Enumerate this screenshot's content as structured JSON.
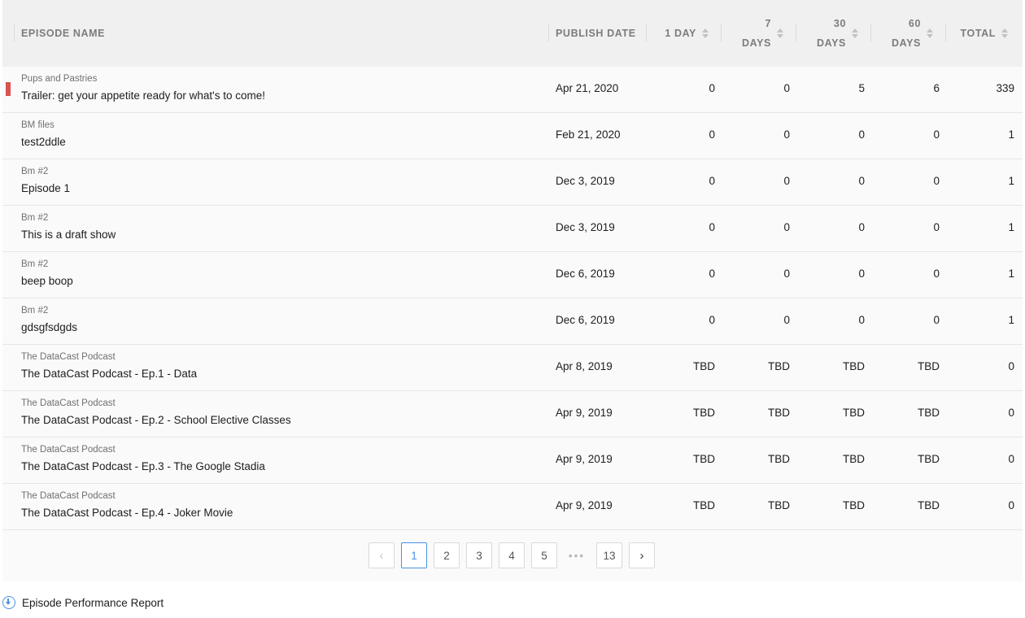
{
  "table": {
    "columns": {
      "episode_name": "EPISODE NAME",
      "publish_date": "PUBLISH DATE",
      "day1": "1 DAY",
      "day7": [
        "7",
        "DAYS"
      ],
      "day30": [
        "30",
        "DAYS"
      ],
      "day60": [
        "60",
        "DAYS"
      ],
      "total": "TOTAL"
    },
    "rows": [
      {
        "show": "Pups and Pastries",
        "episode": "Trailer: get your appetite ready for what's to come!",
        "date": "Apr 21, 2020",
        "d1": "0",
        "d7": "0",
        "d30": "5",
        "d60": "6",
        "total": "339",
        "marker": true
      },
      {
        "show": "BM files",
        "episode": "test2ddle",
        "date": "Feb 21, 2020",
        "d1": "0",
        "d7": "0",
        "d30": "0",
        "d60": "0",
        "total": "1"
      },
      {
        "show": "Bm #2",
        "episode": "Episode 1",
        "date": "Dec 3, 2019",
        "d1": "0",
        "d7": "0",
        "d30": "0",
        "d60": "0",
        "total": "1"
      },
      {
        "show": "Bm #2",
        "episode": "This is a draft show",
        "date": "Dec 3, 2019",
        "d1": "0",
        "d7": "0",
        "d30": "0",
        "d60": "0",
        "total": "1"
      },
      {
        "show": "Bm #2",
        "episode": "beep boop",
        "date": "Dec 6, 2019",
        "d1": "0",
        "d7": "0",
        "d30": "0",
        "d60": "0",
        "total": "1"
      },
      {
        "show": "Bm #2",
        "episode": "gdsgfsdgds",
        "date": "Dec 6, 2019",
        "d1": "0",
        "d7": "0",
        "d30": "0",
        "d60": "0",
        "total": "1"
      },
      {
        "show": "The DataCast Podcast",
        "episode": "The DataCast Podcast - Ep.1 - Data",
        "date": "Apr 8, 2019",
        "d1": "TBD",
        "d7": "TBD",
        "d30": "TBD",
        "d60": "TBD",
        "total": "0"
      },
      {
        "show": "The DataCast Podcast",
        "episode": "The DataCast Podcast - Ep.2 - School Elective Classes",
        "date": "Apr 9, 2019",
        "d1": "TBD",
        "d7": "TBD",
        "d30": "TBD",
        "d60": "TBD",
        "total": "0"
      },
      {
        "show": "The DataCast Podcast",
        "episode": "The DataCast Podcast - Ep.3 - The Google Stadia",
        "date": "Apr 9, 2019",
        "d1": "TBD",
        "d7": "TBD",
        "d30": "TBD",
        "d60": "TBD",
        "total": "0"
      },
      {
        "show": "The DataCast Podcast",
        "episode": "The DataCast Podcast - Ep.4 - Joker Movie",
        "date": "Apr 9, 2019",
        "d1": "TBD",
        "d7": "TBD",
        "d30": "TBD",
        "d60": "TBD",
        "total": "0"
      }
    ]
  },
  "pagination": {
    "prev_icon": "chevron-left-icon",
    "pages": [
      "1",
      "2",
      "3",
      "4",
      "5"
    ],
    "ellipsis": "•••",
    "last_page": "13",
    "current_page": "1",
    "next_icon": "chevron-right-icon"
  },
  "report": {
    "icon": "download-icon",
    "label": "Episode Performance Report"
  },
  "colors": {
    "accent": "#4a90e2",
    "marker": "#d9534f",
    "header_bg": "#f0f0f0"
  }
}
